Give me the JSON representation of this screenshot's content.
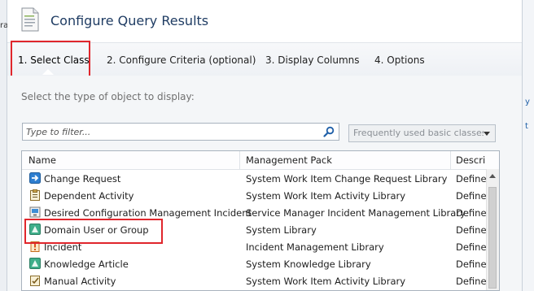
{
  "window": {
    "title": "Configure Query Results"
  },
  "background_fragments": {
    "left": "ra",
    "right": [
      "y",
      "t"
    ]
  },
  "tabs": [
    {
      "label": "1. Select Class",
      "active": true
    },
    {
      "label": "2. Configure Criteria (optional)",
      "active": false
    },
    {
      "label": "3. Display Columns",
      "active": false
    },
    {
      "label": "4. Options",
      "active": false
    }
  ],
  "instruction": "Select the type of object to display:",
  "filter": {
    "placeholder": "Type to filter...",
    "value": ""
  },
  "class_filter": {
    "selected": "Frequently used basic classes"
  },
  "grid": {
    "columns": [
      "Name",
      "Management Pack",
      "Descri"
    ],
    "rows": [
      {
        "icon": "change-request-icon",
        "name": "Change Request",
        "pack": "System Work Item Change Request Library",
        "desc": "Define"
      },
      {
        "icon": "dependent-activity-icon",
        "name": "Dependent Activity",
        "pack": "System Work Item Activity Library",
        "desc": "Define"
      },
      {
        "icon": "config-incident-icon",
        "name": "Desired Configuration Management Incident",
        "pack": "Service Manager Incident Management Library",
        "desc": "Define"
      },
      {
        "icon": "domain-user-icon",
        "name": "Domain User or Group",
        "pack": "System Library",
        "desc": "Define"
      },
      {
        "icon": "incident-icon",
        "name": "Incident",
        "pack": "Incident Management Library",
        "desc": "Define"
      },
      {
        "icon": "knowledge-article-icon",
        "name": "Knowledge Article",
        "pack": "System Knowledge Library",
        "desc": "Define"
      },
      {
        "icon": "manual-activity-icon",
        "name": "Manual Activity",
        "pack": "System Work Item Activity Library",
        "desc": "Define"
      }
    ]
  },
  "colors": {
    "title": "#1f3c63",
    "highlight": "#e0262c",
    "accent": "#1f6fb8"
  }
}
